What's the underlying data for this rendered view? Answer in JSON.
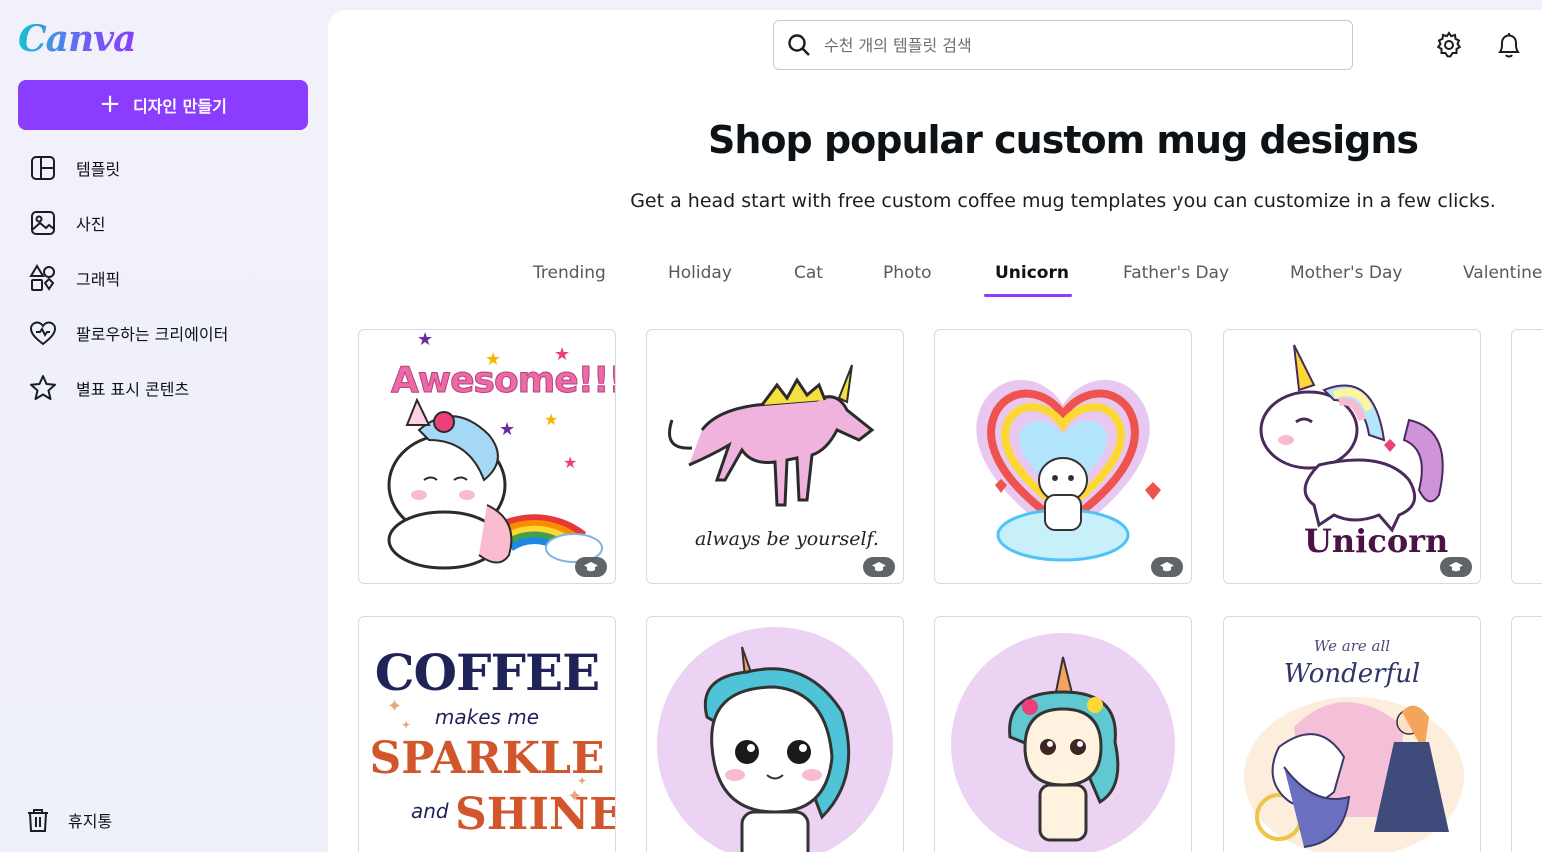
{
  "app": {
    "logo": "Canva"
  },
  "sidebar": {
    "create_label": "디자인 만들기",
    "items": [
      {
        "label": "템플릿",
        "icon": "template-icon"
      },
      {
        "label": "사진",
        "icon": "photo-icon"
      },
      {
        "label": "그래픽",
        "icon": "graphics-icon"
      },
      {
        "label": "팔로우하는 크리에이터",
        "icon": "heart-creator-icon"
      },
      {
        "label": "별표 표시 콘텐츠",
        "icon": "star-icon"
      }
    ],
    "trash_label": "휴지통"
  },
  "search": {
    "placeholder": "수천 개의 템플릿 검색"
  },
  "page": {
    "title": "Shop popular custom mug designs",
    "subtitle": "Get a head start with free custom coffee mug templates you can customize in a few clicks."
  },
  "tabs": [
    {
      "label": "Trending"
    },
    {
      "label": "Holiday"
    },
    {
      "label": "Cat"
    },
    {
      "label": "Photo"
    },
    {
      "label": "Unicorn",
      "active": true
    },
    {
      "label": "Father's Day"
    },
    {
      "label": "Mother's Day"
    },
    {
      "label": "Valentine"
    }
  ],
  "templates": [
    {
      "text": "Awesome!!!",
      "premium_badge": true
    },
    {
      "text": "always be yourself.",
      "premium_badge": true
    },
    {
      "text": "",
      "premium_badge": true
    },
    {
      "text": "Unicorn",
      "premium_badge": true
    },
    {
      "text_lines": [
        "COFFEE",
        "makes me",
        "SPARKLE",
        "and",
        "SHINE"
      ]
    },
    {
      "text": ""
    },
    {
      "text": ""
    },
    {
      "text_lines": [
        "We are all",
        "Wonderful"
      ]
    }
  ],
  "colors": {
    "accent": "#8b3dff",
    "badge": "#5f646b"
  }
}
